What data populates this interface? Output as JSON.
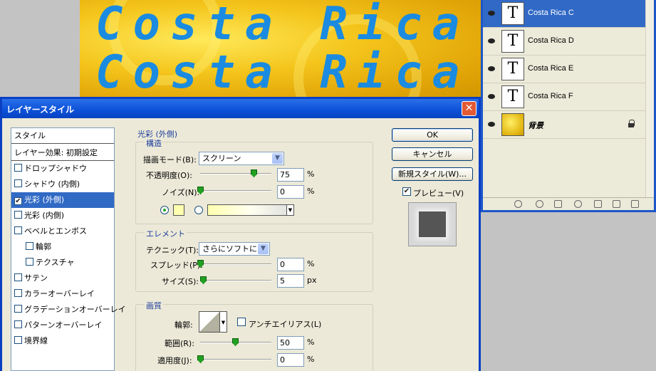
{
  "canvas": {
    "lines": [
      "Costa Rica C",
      "Costa Rica D"
    ]
  },
  "layers": [
    {
      "name": "Costa Rica C",
      "thumb": "T",
      "selected": true
    },
    {
      "name": "Costa Rica D",
      "thumb": "T"
    },
    {
      "name": "Costa Rica E",
      "thumb": "T"
    },
    {
      "name": "Costa Rica F",
      "thumb": "T"
    },
    {
      "name": "背景",
      "thumb": "",
      "locked": true
    }
  ],
  "dialog": {
    "title": "レイヤースタイル",
    "close": "✕",
    "style_list_header": "スタイル",
    "style_list": [
      {
        "label": "レイヤー効果: 初期設定",
        "checkbox": false
      },
      {
        "label": "ドロップシャドウ",
        "checkbox": true,
        "checked": false
      },
      {
        "label": "シャドウ (内側)",
        "checkbox": true,
        "checked": false
      },
      {
        "label": "光彩 (外側)",
        "checkbox": true,
        "checked": true,
        "selected": true
      },
      {
        "label": "光彩 (内側)",
        "checkbox": true,
        "checked": false
      },
      {
        "label": "ベベルとエンボス",
        "checkbox": true,
        "checked": false
      },
      {
        "label": "輪郭",
        "checkbox": true,
        "checked": false,
        "indent": true
      },
      {
        "label": "テクスチャ",
        "checkbox": true,
        "checked": false,
        "indent": true
      },
      {
        "label": "サテン",
        "checkbox": true,
        "checked": false
      },
      {
        "label": "カラーオーバーレイ",
        "checkbox": true,
        "checked": false
      },
      {
        "label": "グラデーションオーバーレイ",
        "checkbox": true,
        "checked": false
      },
      {
        "label": "パターンオーバーレイ",
        "checkbox": true,
        "checked": false
      },
      {
        "label": "境界線",
        "checkbox": true,
        "checked": false
      }
    ],
    "section_title": "光彩 (外側)",
    "structure": {
      "title": "構造",
      "blend_label": "描画モード(B):",
      "blend_value": "スクリーン",
      "opacity_label": "不透明度(O):",
      "opacity_value": "75",
      "noise_label": "ノイズ(N):",
      "noise_value": "0",
      "unit": "%",
      "glow_color": "#ffffb0"
    },
    "elements": {
      "title": "エレメント",
      "technique_label": "テクニック(T):",
      "technique_value": "さらにソフトに",
      "spread_label": "スプレッド(P):",
      "spread_value": "0",
      "spread_unit": "%",
      "size_label": "サイズ(S):",
      "size_value": "5",
      "size_unit": "px"
    },
    "quality": {
      "title": "画質",
      "contour_label": "輪郭:",
      "antialias_label": "アンチエイリアス(L)",
      "range_label": "範囲(R):",
      "range_value": "50",
      "range_unit": "%",
      "jitter_label": "適用度(J):",
      "jitter_value": "0",
      "jitter_unit": "%"
    },
    "buttons": {
      "ok": "OK",
      "cancel": "キャンセル",
      "new_style": "新規スタイル(W)...",
      "preview": "プレビュー(V)"
    }
  },
  "colors": {
    "accent": "#316ac5",
    "titlebar": "#0c50d8",
    "canvas_text": "#1a8be0"
  }
}
